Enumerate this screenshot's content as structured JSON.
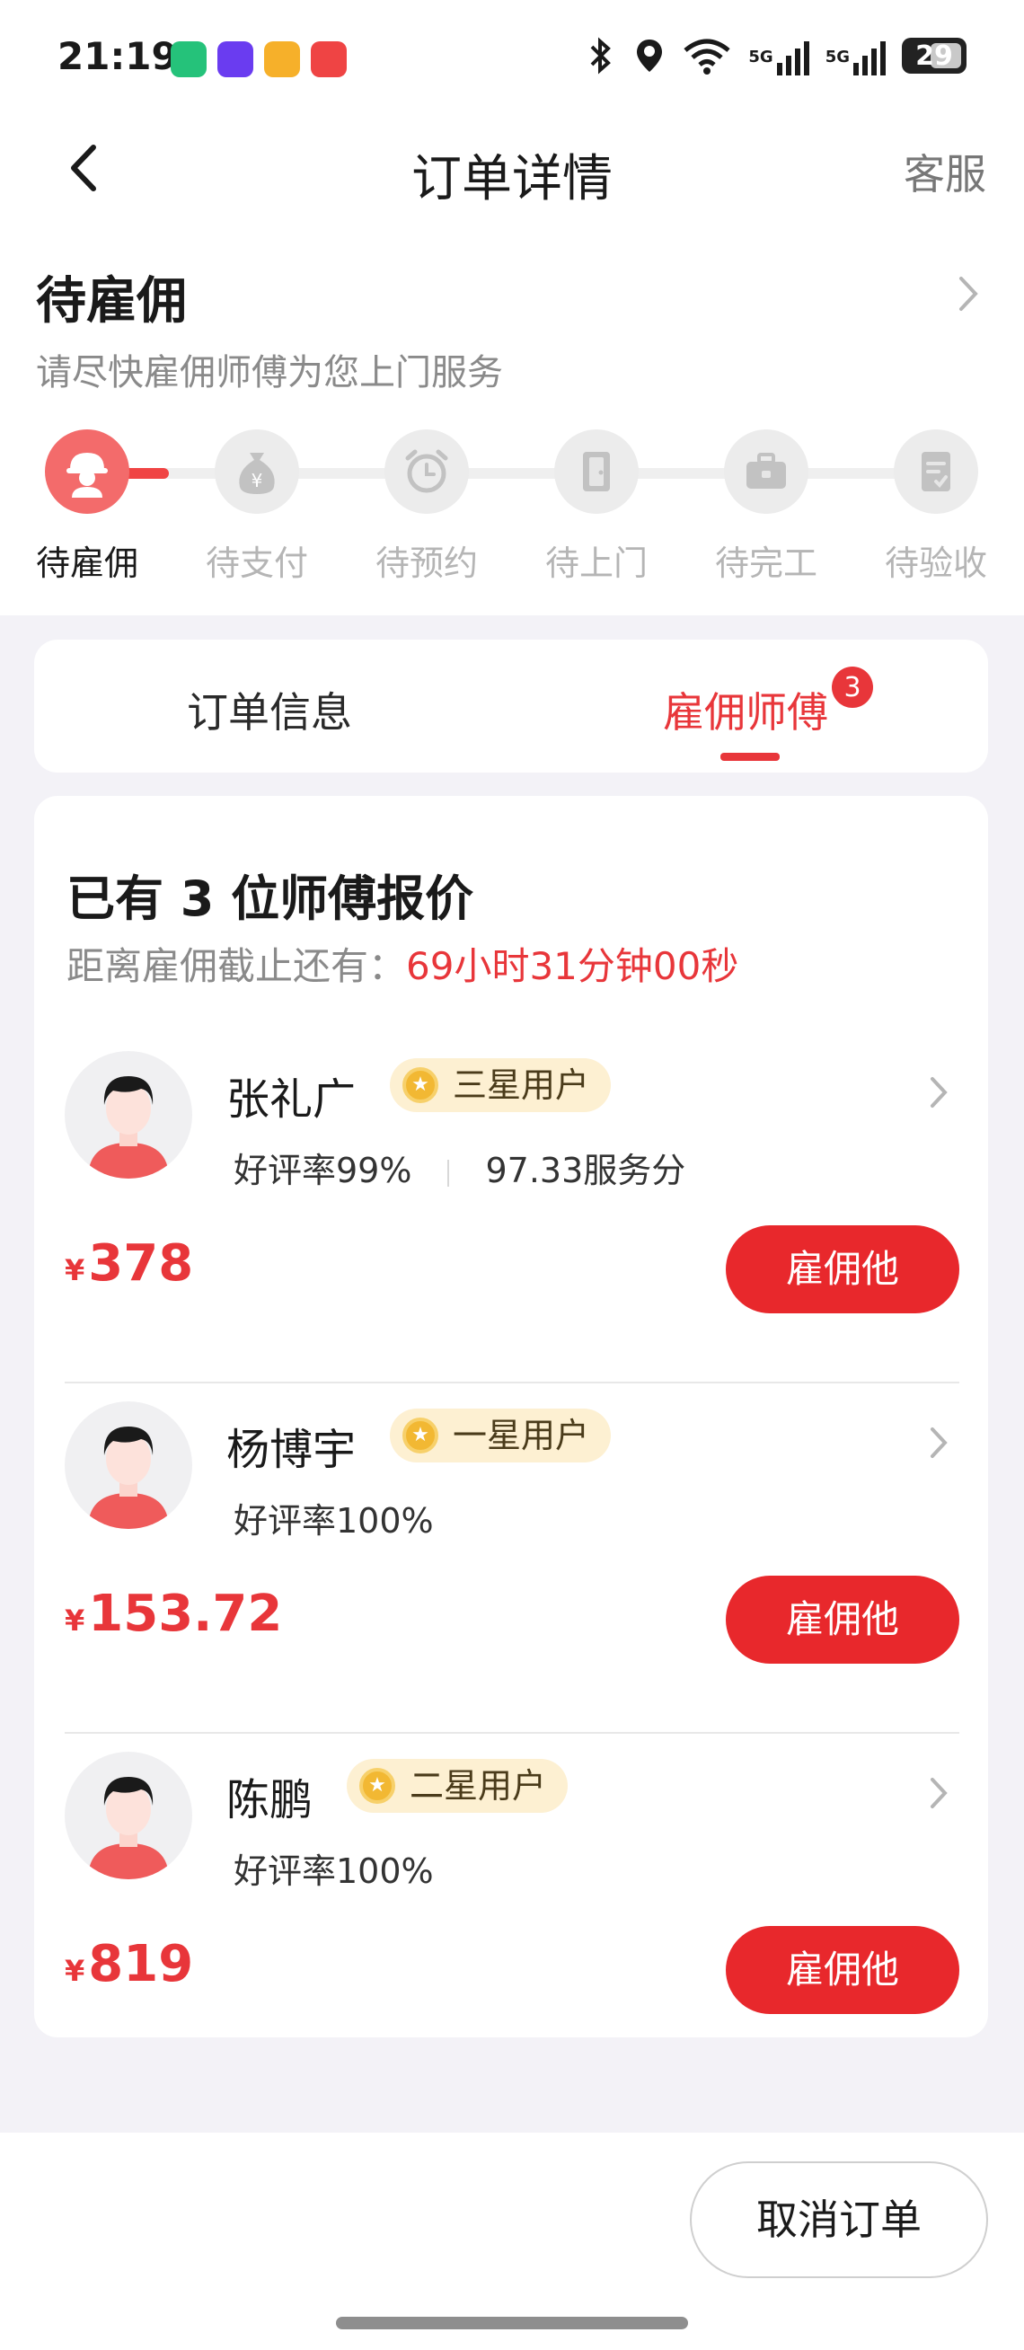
{
  "status_bar": {
    "time": "21:19",
    "network_1": "5G",
    "network_2": "5G",
    "battery": "29",
    "icons": [
      "notification-app-icon",
      "notification-app-icon",
      "notification-app-icon",
      "notification-app-icon",
      "bluetooth-icon",
      "location-icon",
      "wifi-icon",
      "signal-icon",
      "signal-icon",
      "battery-icon"
    ]
  },
  "header": {
    "title": "订单详情",
    "right_action": "客服"
  },
  "order_status": {
    "title": "待雇佣",
    "subtitle": "请尽快雇佣师傅为您上门服务",
    "steps": [
      {
        "label": "待雇佣",
        "icon": "worker-icon",
        "active": true
      },
      {
        "label": "待支付",
        "icon": "money-bag-icon",
        "active": false
      },
      {
        "label": "待预约",
        "icon": "alarm-clock-icon",
        "active": false
      },
      {
        "label": "待上门",
        "icon": "door-icon",
        "active": false
      },
      {
        "label": "待完工",
        "icon": "toolbox-icon",
        "active": false
      },
      {
        "label": "待验收",
        "icon": "checklist-icon",
        "active": false
      }
    ]
  },
  "tabs": {
    "order_info": "订单信息",
    "hire_master": "雇佣师傅",
    "badge": "3",
    "active": "hire_master"
  },
  "quotes": {
    "title": "已有 3 位师傅报价",
    "deadline_label": "距离雇佣截止还有：",
    "deadline_value": "69小时31分钟00秒",
    "currency": "¥",
    "hire_label": "雇佣他",
    "workers": [
      {
        "name": "张礼广",
        "level": "三星用户",
        "rating": "好评率99%",
        "score": "97.33服务分",
        "price": "378"
      },
      {
        "name": "杨博宇",
        "level": "一星用户",
        "rating": "好评率100%",
        "score": "",
        "price": "153.72"
      },
      {
        "name": "陈鹏",
        "level": "二星用户",
        "rating": "好评率100%",
        "score": "",
        "price": "819"
      }
    ]
  },
  "footer": {
    "cancel_label": "取消订单"
  },
  "colors": {
    "accent": "#e8363a",
    "button": "#e8282c",
    "badge_bg": "#fdf0d2",
    "coin": "#f2b833"
  }
}
